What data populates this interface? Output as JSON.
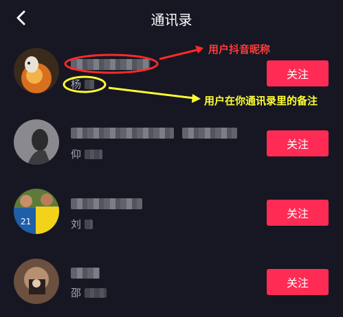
{
  "header": {
    "title": "通讯录",
    "back_icon": "chevron-left-icon"
  },
  "contacts": [
    {
      "surname": "杨",
      "follow_label": "关注"
    },
    {
      "surname": "仰",
      "follow_label": "关注"
    },
    {
      "surname": "刘",
      "follow_label": "关注"
    },
    {
      "surname": "邵",
      "follow_label": "关注"
    }
  ],
  "annotations": {
    "nickname_note": "用户抖音昵称",
    "remark_note": "用户在你通讯录里的备注"
  },
  "colors": {
    "background": "#161722",
    "follow_button": "#fe2c55",
    "annotation_red": "#ff2a2a",
    "annotation_yellow": "#ffff33"
  }
}
